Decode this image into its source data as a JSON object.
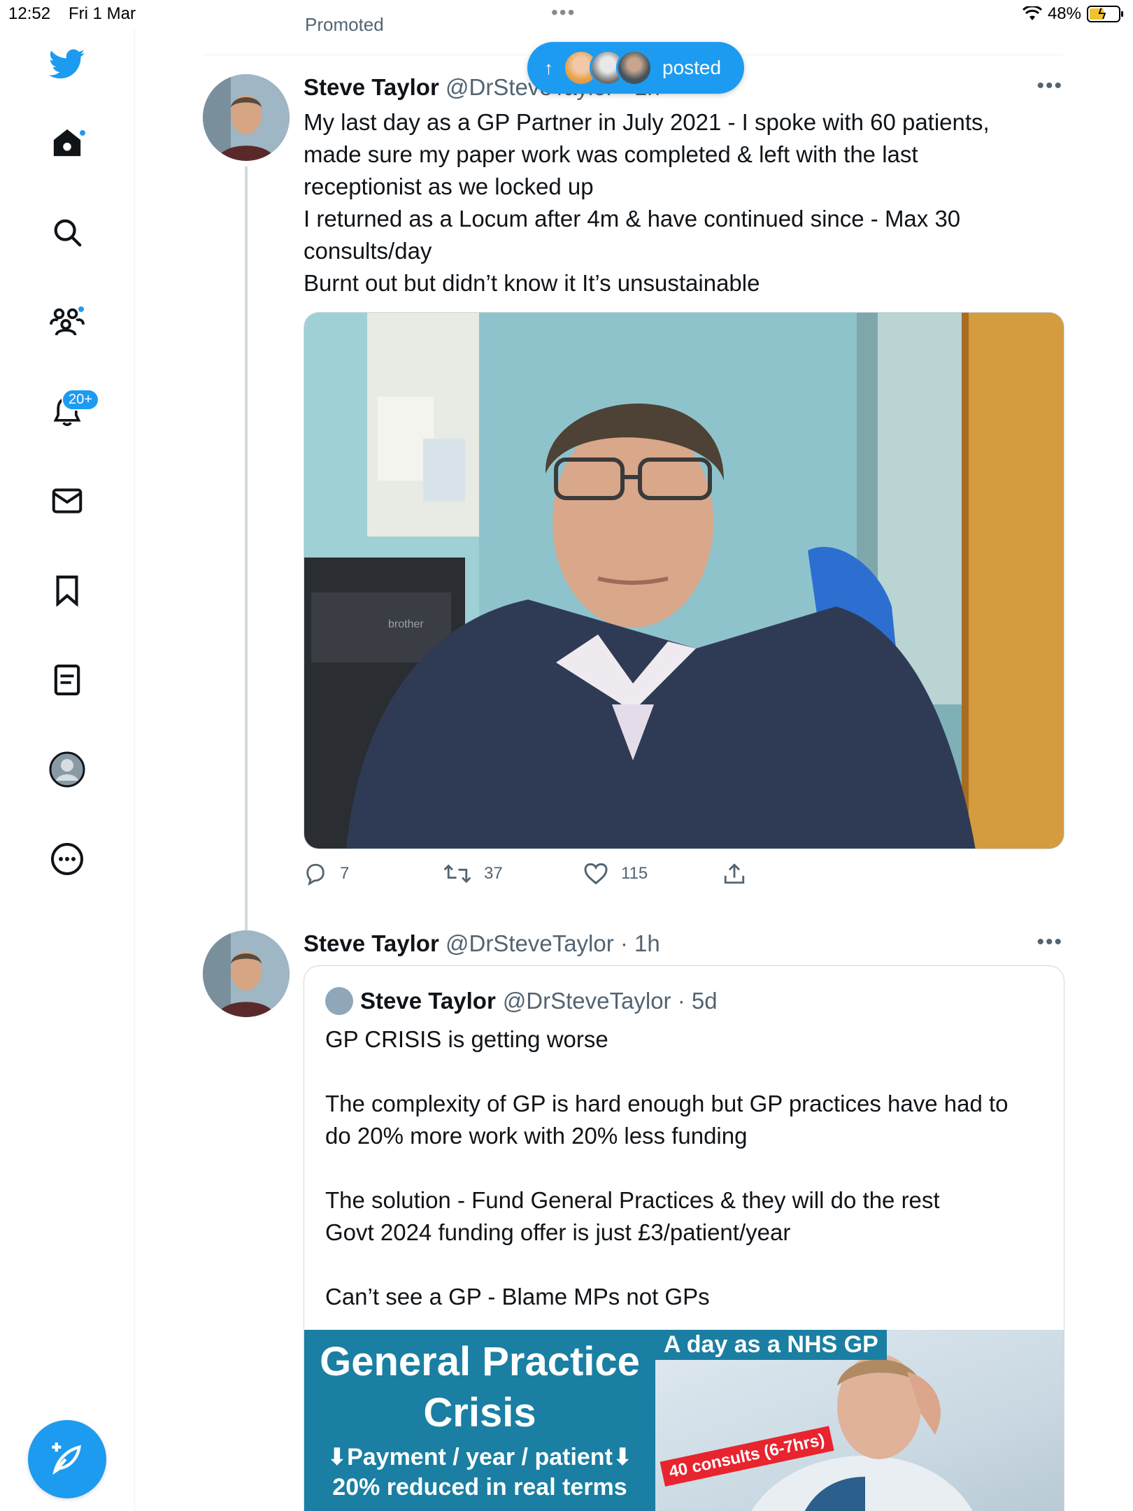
{
  "status_bar": {
    "time": "12:52",
    "date": "Fri 1 Mar",
    "battery": "48%"
  },
  "sidebar": {
    "notifications_badge": "20+"
  },
  "timeline": {
    "promoted_label": "Promoted",
    "posted_pill": "posted"
  },
  "tweet1": {
    "name": "Steve Taylor",
    "handle": "@DrSteveTaylor · 1h",
    "text": "My last day as a GP Partner in July 2021 - I spoke with 60 patients,\nmade sure my paper work was completed & left with the last\nreceptionist as we locked up\nI returned as a Locum after 4m & have continued since - Max 30\nconsults/day\nBurnt out but didn’t know it It’s unsustainable",
    "printer_brand": "brother",
    "replies": "7",
    "retweets": "37",
    "likes": "115"
  },
  "tweet2": {
    "name": "Steve Taylor",
    "handle": "@DrSteveTaylor · 1h",
    "quote": {
      "name": "Steve Taylor",
      "handle": "@DrSteveTaylor · 5d",
      "text": "GP CRISIS is getting worse\n\nThe complexity of GP is hard enough but GP practices have had to\ndo 20% more work with 20% less funding\n\nThe solution - Fund General Practices & they will do the rest\nGovt 2024 funding offer is just £3/patient/year\n\nCan’t see a GP - Blame MPs not GPs",
      "card_left": {
        "title_line1": "General Practice",
        "title_line2": "Crisis",
        "line1": "⬇Payment / year / patient⬇",
        "line2": "20% reduced in real terms"
      },
      "card_right": {
        "header": "A day as a NHS GP",
        "tag": "40 consults (6-7hrs)"
      }
    }
  }
}
